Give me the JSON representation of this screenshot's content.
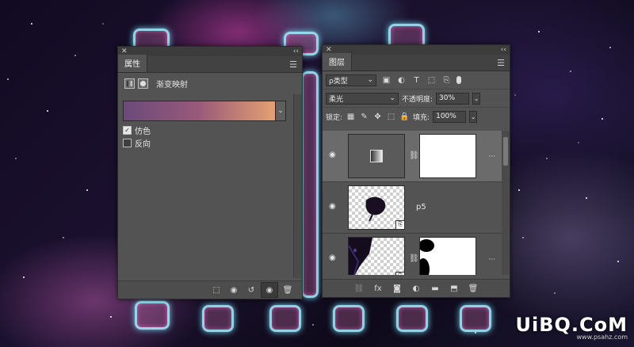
{
  "properties_panel": {
    "close_glyph": "✕",
    "collapse_glyph": "‹‹",
    "tab_label": "属性",
    "menu_glyph": "☰",
    "adjustment_title": "渐变映射",
    "gradient_colors": [
      "#6a4a7a",
      "#9a5a7a",
      "#e4a072"
    ],
    "dither_label": "仿色",
    "dither_checked": true,
    "reverse_label": "反向",
    "reverse_checked": false,
    "footer_icons": [
      "clip-to-layer-icon",
      "view-previous-state-icon",
      "reset-icon",
      "visibility-icon",
      "delete-icon"
    ]
  },
  "layers_panel": {
    "close_glyph": "✕",
    "collapse_glyph": "‹‹",
    "tab_label": "图层",
    "menu_glyph": "☰",
    "filter_label": "ρ类型",
    "blend_mode": "柔光",
    "opacity_label": "不透明度:",
    "opacity_value": "30%",
    "lock_label": "锁定:",
    "fill_label": "填充:",
    "fill_value": "100%",
    "layers": [
      {
        "name": "",
        "kind": "adjustment",
        "selected": true
      },
      {
        "name": "p5",
        "kind": "smart-object",
        "selected": false
      },
      {
        "name": "",
        "kind": "smart-object-masked",
        "selected": false
      }
    ]
  },
  "watermark": {
    "text": "UiBQ.CoM",
    "subtext": "www.psahz.com"
  }
}
